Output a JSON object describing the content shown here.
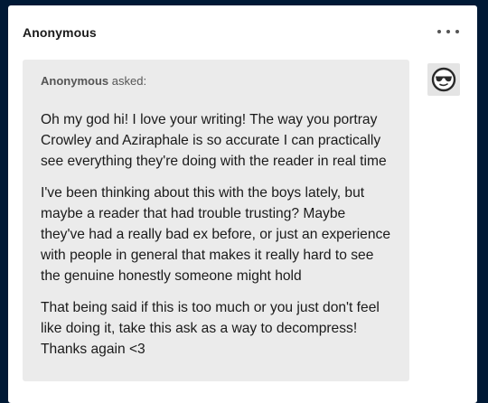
{
  "post": {
    "blog_name": "Anonymous",
    "more_icon": "ellipsis-icon",
    "ask": {
      "asker_name": "Anonymous",
      "asked_label": "asked:",
      "avatar_icon": "sunglasses-face-icon",
      "paragraphs": [
        "Oh my god hi! I love your writing! The way you portray Crowley and Aziraphale is so accurate I can practically see everything they're doing with the reader in real time",
        "I've been thinking about this with the boys lately, but maybe a reader that had trouble trusting? Maybe they've had a really bad ex before, or just an experience with people in general that makes it really hard to see the genuine honestly someone might hold",
        "That being said if this is too much or you just don't feel like doing it, take this ask as a way to decompress! Thanks again <3"
      ]
    }
  },
  "colors": {
    "page_background": "#001935",
    "card_background": "#ffffff",
    "bubble_background": "#ebebeb",
    "text": "#1a1a1a",
    "muted_text": "#555555"
  }
}
